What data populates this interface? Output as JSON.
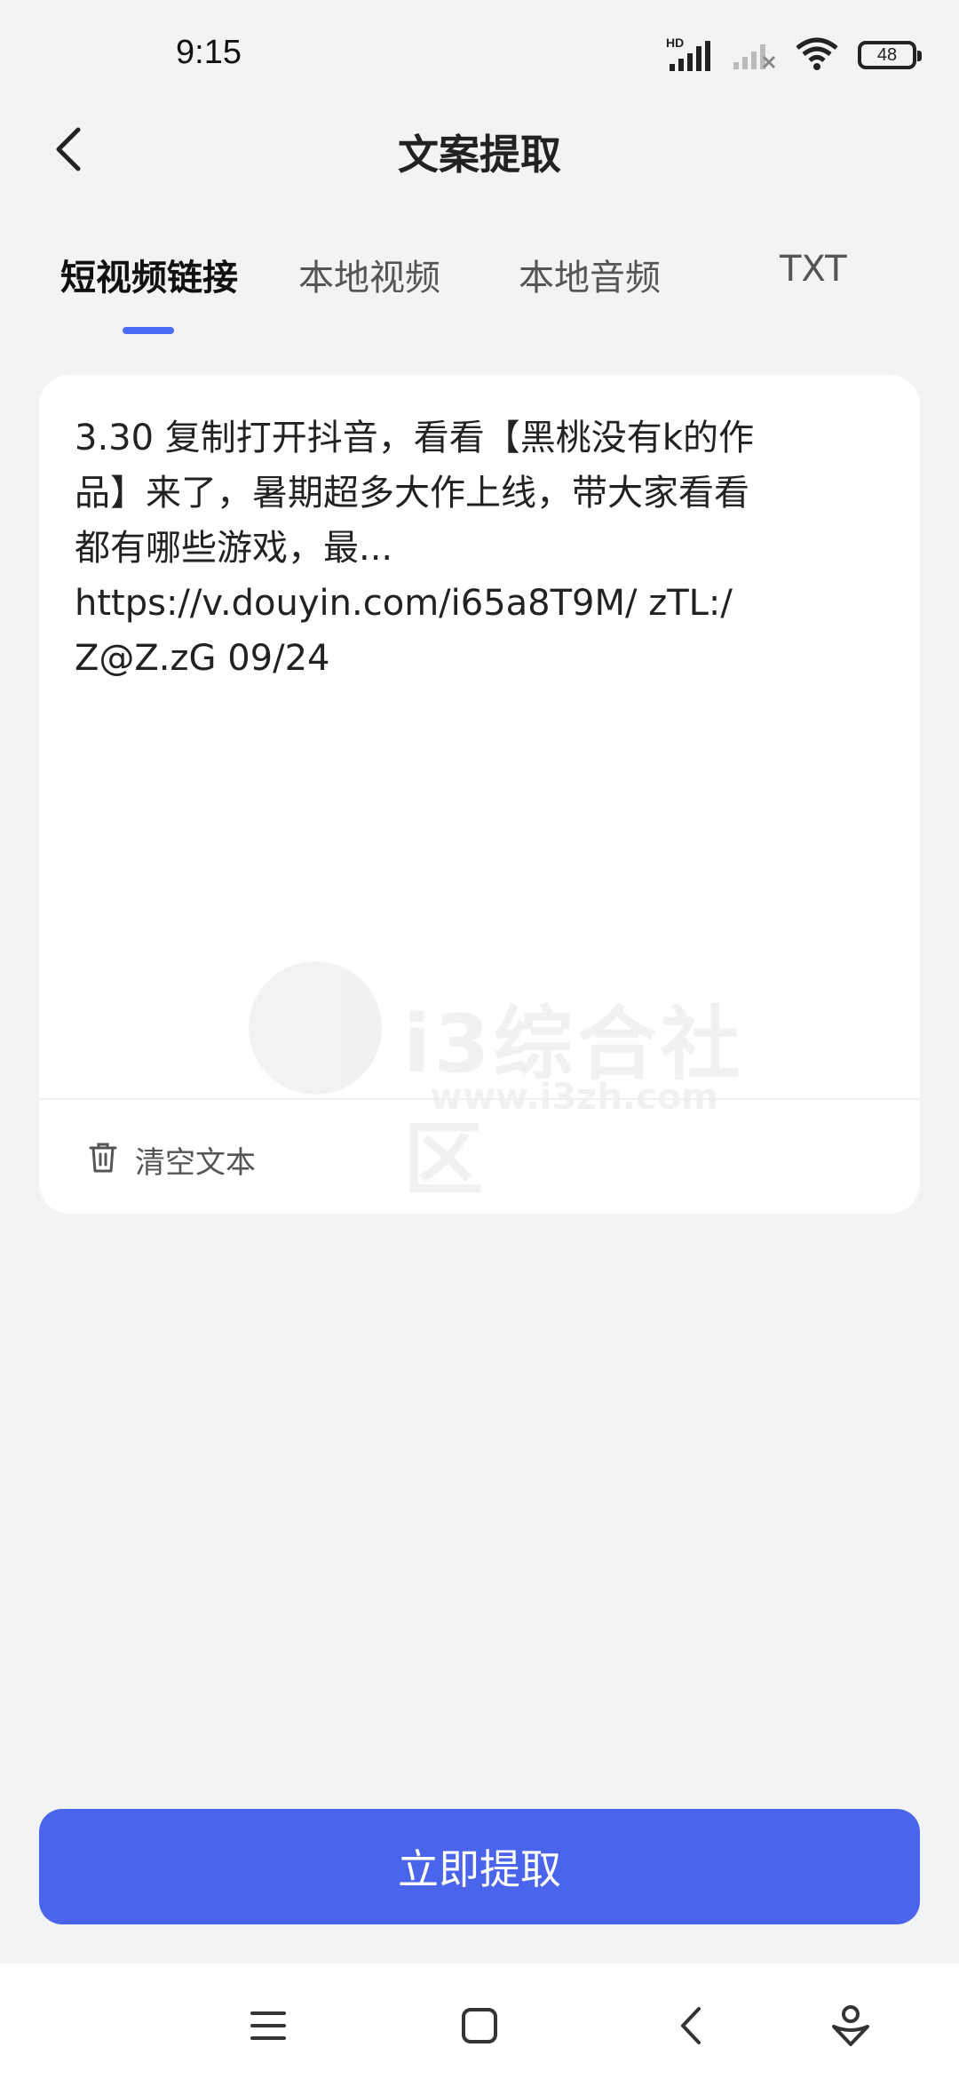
{
  "status_bar": {
    "time": "9:15",
    "network_label": "HD",
    "battery": "48",
    "icons": [
      "signal-icon",
      "signal-off-icon",
      "wifi-icon",
      "battery-icon"
    ]
  },
  "header": {
    "title": "文案提取",
    "back_icon": "chevron-left-icon"
  },
  "tabs": [
    {
      "label": "短视频链接",
      "active": true
    },
    {
      "label": "本地视频",
      "active": false
    },
    {
      "label": "本地音频",
      "active": false
    },
    {
      "label": "TXT",
      "active": false
    }
  ],
  "input": {
    "lines": [
      "3.30 复制打开抖音，看看【黑桃没有k的作",
      "品】来了，暑期超多大作上线，带大家看看",
      "都有哪些游戏，最...",
      "https://v.douyin.com/i65a8T9M/ zTL:/",
      "Z@Z.zG 09/24"
    ]
  },
  "watermark": {
    "text": "i3综合社区",
    "url": "www.i3zh.com"
  },
  "clear_button": {
    "label": "清空文本",
    "icon": "trash-icon"
  },
  "extract_button": {
    "label": "立即提取"
  },
  "colors": {
    "accent": "#4a65eb",
    "background": "#f2f3f5"
  },
  "nav_bar": {
    "icons": [
      "menu-icon",
      "home-icon",
      "back-icon",
      "assistant-icon"
    ]
  }
}
